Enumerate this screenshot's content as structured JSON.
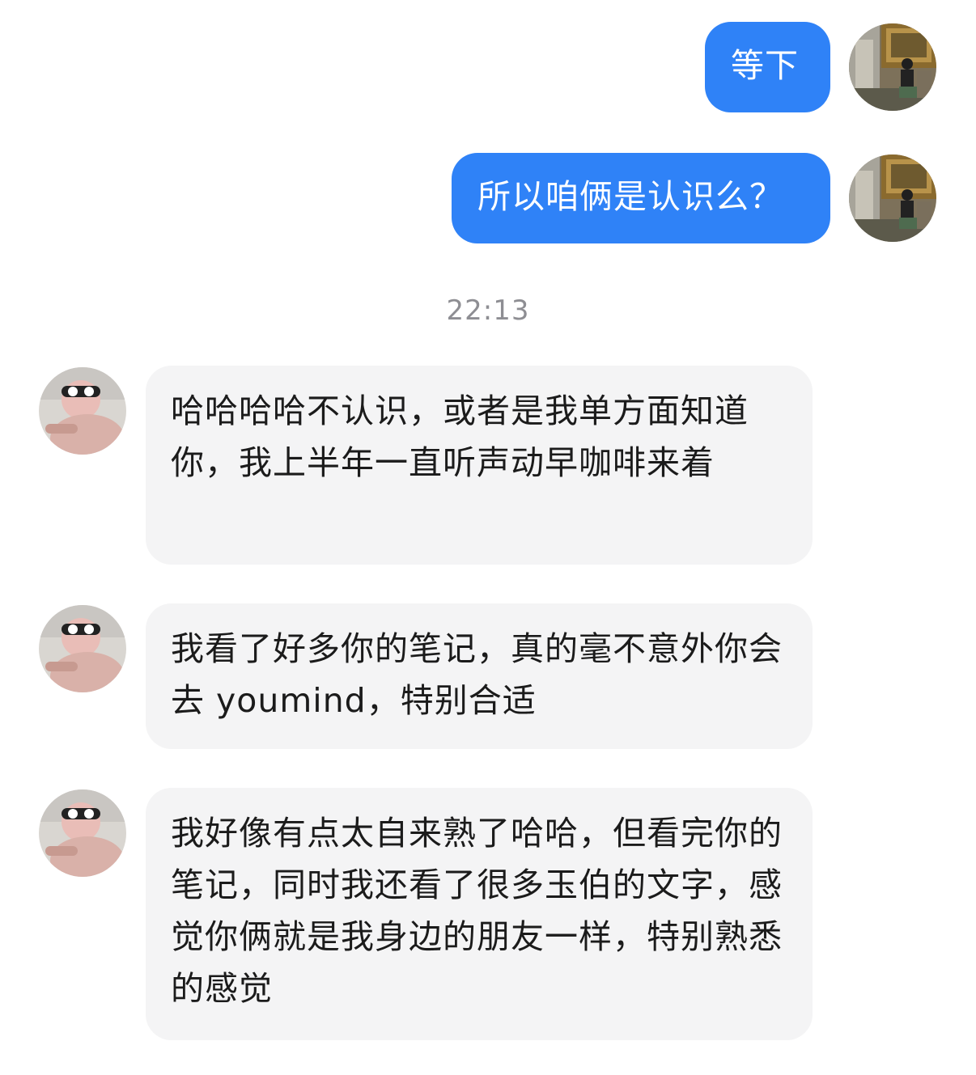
{
  "messages": [
    {
      "direction": "outgoing",
      "sender": "me",
      "text": "等下"
    },
    {
      "direction": "outgoing",
      "sender": "me",
      "text": "所以咱俩是认识么？"
    },
    {
      "direction": "incoming",
      "sender": "friend",
      "text": "哈哈哈哈不认识，或者是我单方面知道你，我上半年一直听声动早咖啡来着"
    },
    {
      "direction": "incoming",
      "sender": "friend",
      "text": "我看了好多你的笔记，真的毫不意外你会去 youmind，特别合适"
    },
    {
      "direction": "incoming",
      "sender": "friend",
      "text": "我好像有点太自来熟了哈哈，但看完你的笔记，同时我还看了很多玉伯的文字，感觉你俩就是我身边的朋友一样，特别熟悉的感觉"
    }
  ],
  "timestamp": "22:13",
  "colors": {
    "outgoing_bubble": "#2f82f7",
    "incoming_bubble": "#f4f4f5",
    "timestamp_text": "#8e8e93"
  },
  "icons": {
    "self_avatar": "user-avatar-photo",
    "friend_avatar": "friend-avatar-photo"
  }
}
